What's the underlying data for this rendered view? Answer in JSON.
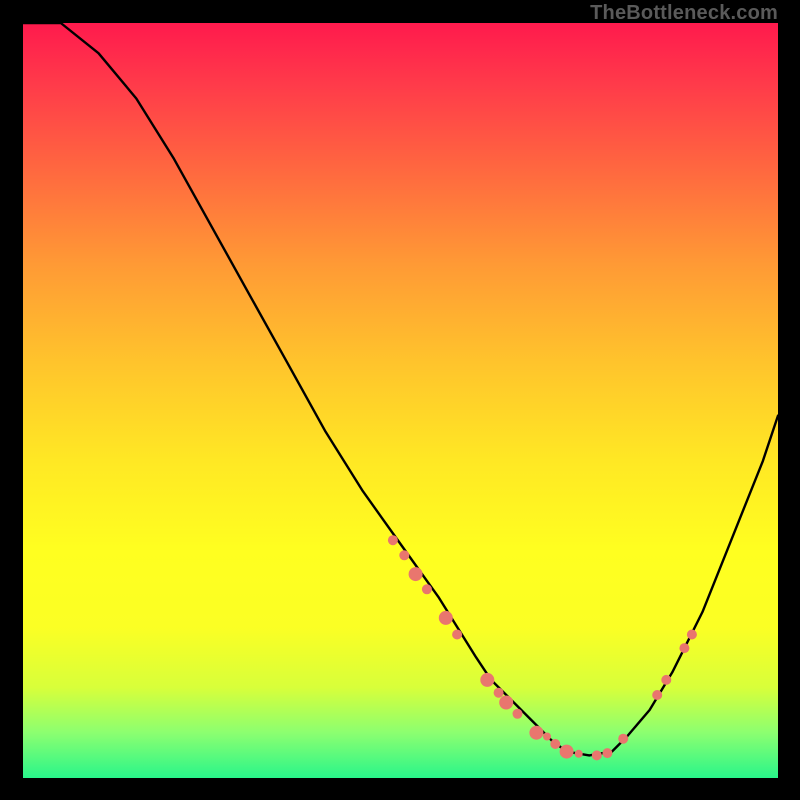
{
  "watermark": "TheBottleneck.com",
  "chart_data": {
    "type": "line",
    "title": "",
    "xlabel": "",
    "ylabel": "",
    "xlim": [
      0,
      100
    ],
    "ylim": [
      0,
      100
    ],
    "series": [
      {
        "name": "curve",
        "x": [
          0,
          5,
          10,
          15,
          20,
          25,
          30,
          35,
          40,
          45,
          50,
          55,
          60,
          62,
          65,
          68,
          70,
          72,
          75,
          78,
          80,
          83,
          86,
          90,
          94,
          98,
          100
        ],
        "y": [
          100,
          100,
          96,
          90,
          82,
          73,
          64,
          55,
          46,
          38,
          31,
          24,
          16,
          13,
          10,
          7,
          5,
          3.5,
          3,
          3.5,
          5.5,
          9,
          14,
          22,
          32,
          42,
          48
        ]
      }
    ],
    "markers": {
      "name": "highlighted-points",
      "color": "#e9766e",
      "points": [
        {
          "x": 49.0,
          "y": 31.5,
          "r": 5
        },
        {
          "x": 50.5,
          "y": 29.5,
          "r": 5
        },
        {
          "x": 52.0,
          "y": 27.0,
          "r": 7
        },
        {
          "x": 53.5,
          "y": 25.0,
          "r": 5
        },
        {
          "x": 56.0,
          "y": 21.2,
          "r": 7
        },
        {
          "x": 57.5,
          "y": 19.0,
          "r": 5
        },
        {
          "x": 61.5,
          "y": 13.0,
          "r": 7
        },
        {
          "x": 63.0,
          "y": 11.3,
          "r": 5
        },
        {
          "x": 64.0,
          "y": 10.0,
          "r": 7
        },
        {
          "x": 65.5,
          "y": 8.5,
          "r": 5
        },
        {
          "x": 68.0,
          "y": 6.0,
          "r": 7
        },
        {
          "x": 69.4,
          "y": 5.5,
          "r": 4
        },
        {
          "x": 70.5,
          "y": 4.5,
          "r": 5
        },
        {
          "x": 72.0,
          "y": 3.5,
          "r": 7
        },
        {
          "x": 73.6,
          "y": 3.2,
          "r": 4
        },
        {
          "x": 76.0,
          "y": 3.0,
          "r": 5
        },
        {
          "x": 77.4,
          "y": 3.3,
          "r": 5
        },
        {
          "x": 79.5,
          "y": 5.2,
          "r": 5
        },
        {
          "x": 84.0,
          "y": 11.0,
          "r": 5
        },
        {
          "x": 85.2,
          "y": 13.0,
          "r": 5
        },
        {
          "x": 87.6,
          "y": 17.2,
          "r": 5
        },
        {
          "x": 88.6,
          "y": 19.0,
          "r": 5
        }
      ]
    }
  }
}
